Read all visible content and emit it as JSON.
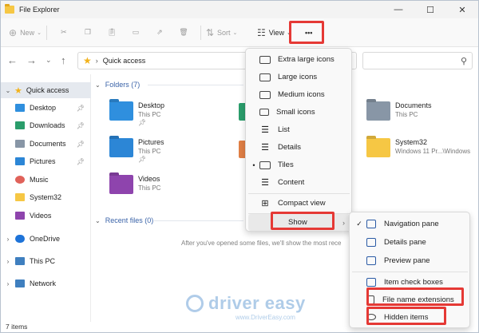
{
  "window": {
    "title": "File Explorer",
    "minimize": "—",
    "maximize": "☐",
    "close": "✕"
  },
  "toolbar": {
    "new_label": "New",
    "sort_label": "Sort",
    "view_label": "View",
    "more_label": "•••",
    "icons": [
      "cut-icon",
      "copy-icon",
      "paste-icon",
      "rename-icon",
      "share-icon",
      "delete-icon"
    ]
  },
  "address": {
    "path": "Quick access",
    "search_placeholder": ""
  },
  "sidebar": {
    "items": [
      {
        "label": "Quick access",
        "selected": true,
        "color": "#f2b21b"
      },
      {
        "label": "Desktop",
        "pinned": true,
        "color": "#2f8fde"
      },
      {
        "label": "Downloads",
        "pinned": true,
        "color": "#2a9d6b"
      },
      {
        "label": "Documents",
        "pinned": true,
        "color": "#8896a6"
      },
      {
        "label": "Pictures",
        "pinned": true,
        "color": "#2c86d6"
      },
      {
        "label": "Music",
        "color": "#e0625a"
      },
      {
        "label": "System32",
        "color": "#f6c744"
      },
      {
        "label": "Videos",
        "color": "#8e44ad"
      },
      {
        "label": "OneDrive",
        "color": "#1e73d8"
      },
      {
        "label": "This PC",
        "color": "#3f7fbf"
      },
      {
        "label": "Network",
        "color": "#3f7fbf"
      }
    ]
  },
  "main": {
    "folders_header": "Folders (7)",
    "recent_header": "Recent files (0)",
    "recent_message": "After you've opened some files, we'll show the most rece",
    "folders": [
      {
        "name": "Desktop",
        "sub": "This PC",
        "pinned": true,
        "color": "#2f8fde"
      },
      {
        "name": "Pictures",
        "sub": "This PC",
        "pinned": true,
        "color": "#2c86d6"
      },
      {
        "name": "Videos",
        "sub": "This PC",
        "pinned": false,
        "color": "#8e44ad"
      },
      {
        "name": "Documents",
        "sub": "This PC",
        "pinned": false,
        "color": "#8896a6"
      },
      {
        "name": "System32",
        "sub": "Windows 11 Pr...\\Windows",
        "pinned": false,
        "color": "#f6c744"
      }
    ]
  },
  "view_menu": {
    "items": [
      {
        "label": "Extra large icons",
        "icon": "extra-large-icons-icon"
      },
      {
        "label": "Large icons",
        "icon": "large-icons-icon"
      },
      {
        "label": "Medium icons",
        "icon": "medium-icons-icon"
      },
      {
        "label": "Small icons",
        "icon": "small-icons-icon"
      },
      {
        "label": "List",
        "icon": "list-icon"
      },
      {
        "label": "Details",
        "icon": "details-icon"
      },
      {
        "label": "Tiles",
        "icon": "tiles-icon",
        "selected": true
      },
      {
        "label": "Content",
        "icon": "content-icon"
      },
      {
        "label": "Compact view",
        "icon": "compact-view-icon"
      },
      {
        "label": "Show",
        "icon": "",
        "hover": true
      }
    ]
  },
  "show_menu": {
    "items": [
      {
        "label": "Navigation pane",
        "checked": true
      },
      {
        "label": "Details pane",
        "checked": false
      },
      {
        "label": "Preview pane",
        "checked": false
      },
      {
        "label": "Item check boxes",
        "checked": false
      },
      {
        "label": "File name extensions",
        "checked": false
      },
      {
        "label": "Hidden items",
        "checked": false
      }
    ]
  },
  "status": {
    "text": "7 items"
  },
  "watermark": {
    "brand": "driver easy",
    "url": "www.DriverEasy.com"
  },
  "colors": {
    "highlight": "#e53935",
    "accent": "#3a63a8"
  }
}
